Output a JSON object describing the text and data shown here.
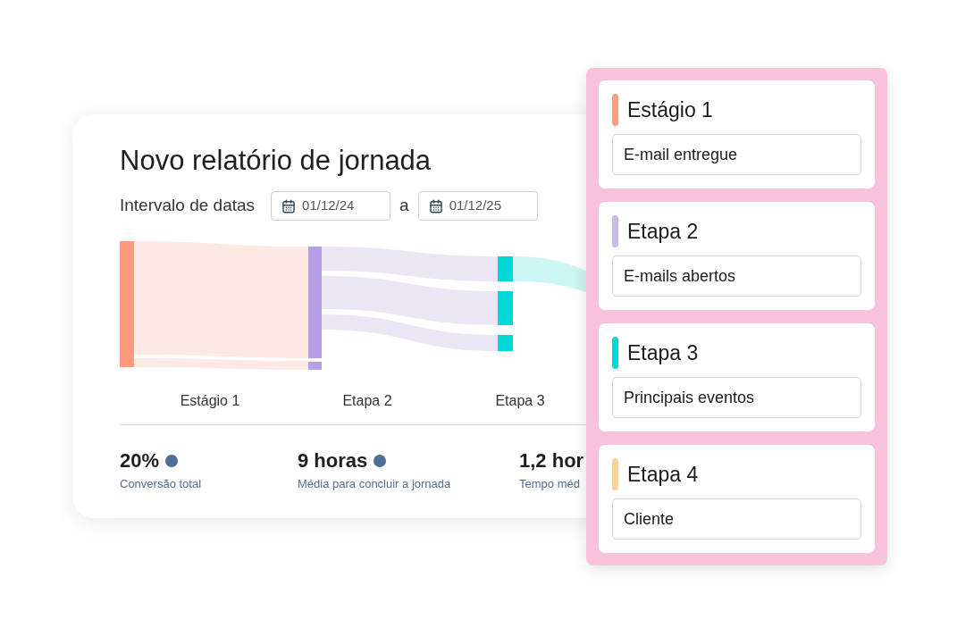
{
  "report": {
    "title": "Novo relatório de jornada",
    "date_range": {
      "label": "Intervalo de datas",
      "start": "01/12/24",
      "separator": "a",
      "end": "01/12/25"
    },
    "journey_chart": {
      "stage_labels": [
        "Estágio 1",
        "Etapa 2",
        "Etapa 3"
      ]
    },
    "stats": [
      {
        "value": "20%",
        "label": "Conversão total",
        "marker": true
      },
      {
        "value": "9 horas",
        "label": "Média para concluir a jornada",
        "marker": true
      },
      {
        "value": "1,2 hor",
        "label": "Tempo méd",
        "marker": false
      }
    ]
  },
  "stages_panel": {
    "stages": [
      {
        "title": "Estágio 1",
        "color": "#ff9d7e",
        "field_value": "E-mail entregue"
      },
      {
        "title": "Etapa 2",
        "color": "#c6bbeb",
        "field_value": "E-mails abertos"
      },
      {
        "title": "Etapa 3",
        "color": "#00d8d8",
        "field_value": "Principais eventos"
      },
      {
        "title": "Etapa 4",
        "color": "#fed09a",
        "field_value": "Cliente"
      }
    ]
  }
}
